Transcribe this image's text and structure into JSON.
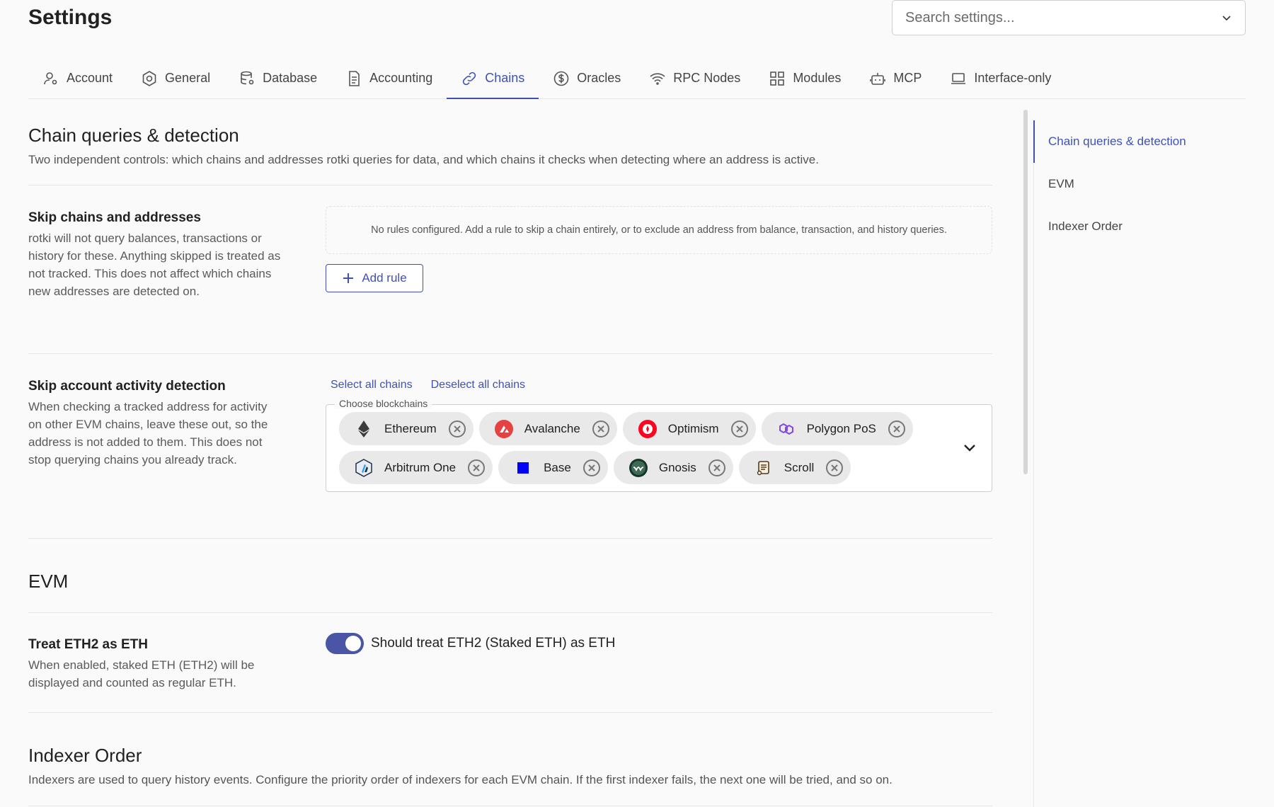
{
  "header": {
    "title": "Settings",
    "search_placeholder": "Search settings..."
  },
  "tabs": [
    {
      "label": "Account",
      "icon": "user-gear-icon"
    },
    {
      "label": "General",
      "icon": "hexagon-icon"
    },
    {
      "label": "Database",
      "icon": "database-icon"
    },
    {
      "label": "Accounting",
      "icon": "file-list-icon"
    },
    {
      "label": "Chains",
      "icon": "link-icon",
      "active": true
    },
    {
      "label": "Oracles",
      "icon": "dollar-coin-icon"
    },
    {
      "label": "RPC Nodes",
      "icon": "wifi-icon"
    },
    {
      "label": "Modules",
      "icon": "grid-icon"
    },
    {
      "label": "MCP",
      "icon": "robot-icon"
    },
    {
      "label": "Interface-only",
      "icon": "laptop-icon"
    }
  ],
  "chain_queries": {
    "title": "Chain queries & detection",
    "description": "Two independent controls: which chains and addresses rotki queries for data, and which chains it checks when detecting where an address is active."
  },
  "skip_chains": {
    "title": "Skip chains and addresses",
    "description": "rotki will not query balances, transactions or history for these. Anything skipped is treated as not tracked. This does not affect which chains new addresses are detected on.",
    "empty_text": "No rules configured. Add a rule to skip a chain entirely, or to exclude an address from balance, transaction, and history queries.",
    "add_rule_label": "Add rule"
  },
  "skip_detection": {
    "title": "Skip account activity detection",
    "description": "When checking a tracked address for activity on other EVM chains, leave these out, so the address is not added to them. This does not stop querying chains you already track.",
    "select_all_label": "Select all chains",
    "deselect_all_label": "Deselect all chains",
    "field_label": "Choose blockchains",
    "chips": [
      {
        "label": "Ethereum",
        "icon": "ethereum-icon"
      },
      {
        "label": "Avalanche",
        "icon": "avalanche-icon"
      },
      {
        "label": "Optimism",
        "icon": "optimism-icon"
      },
      {
        "label": "Polygon PoS",
        "icon": "polygon-icon"
      },
      {
        "label": "Arbitrum One",
        "icon": "arbitrum-icon"
      },
      {
        "label": "Base",
        "icon": "base-icon"
      },
      {
        "label": "Gnosis",
        "icon": "gnosis-icon"
      },
      {
        "label": "Scroll",
        "icon": "scroll-icon"
      }
    ]
  },
  "evm": {
    "title": "EVM",
    "eth2": {
      "title": "Treat ETH2 as ETH",
      "description": "When enabled, staked ETH (ETH2) will be displayed and counted as regular ETH.",
      "toggle_label": "Should treat ETH2 (Staked ETH) as ETH",
      "enabled": true
    }
  },
  "indexer": {
    "title": "Indexer Order",
    "description": "Indexers are used to query history events. Configure the priority order of indexers for each EVM chain. If the first indexer fails, the next one will be tried, and so on."
  },
  "side_nav": [
    {
      "label": "Chain queries & detection",
      "active": true
    },
    {
      "label": "EVM"
    },
    {
      "label": "Indexer Order"
    }
  ],
  "colors": {
    "accent": "#3f51b5",
    "toggle_on": "#4a55a5"
  }
}
